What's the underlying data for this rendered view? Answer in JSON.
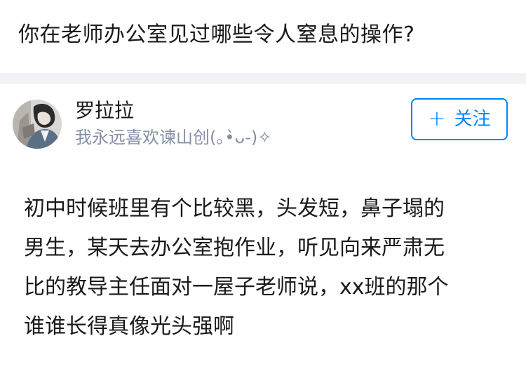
{
  "question": {
    "title": "你在老师办公室见过哪些令人窒息的操作?"
  },
  "author": {
    "name": "罗拉拉",
    "bio": "我永远喜欢谏山创(｡•̀ᴗ-)✧",
    "avatar_icon": "avatar-illustration",
    "follow_label": "关注",
    "follow_icon": "plus-icon",
    "follow_symbol": "+"
  },
  "answer": {
    "lines": [
      "初中时候班里有个比较黑，头发短，鼻子塌的",
      "男生，某天去办公室抱作业，听见向来严肃无",
      "比的教导主任面对一屋子老师说，xx班的那个",
      "谁谁长得真像光头强啊"
    ]
  },
  "colors": {
    "accent": "#0084ff",
    "secondary_text": "#8590a6",
    "divider": "#f0f2f5",
    "primary_text": "#1a1a1a"
  }
}
